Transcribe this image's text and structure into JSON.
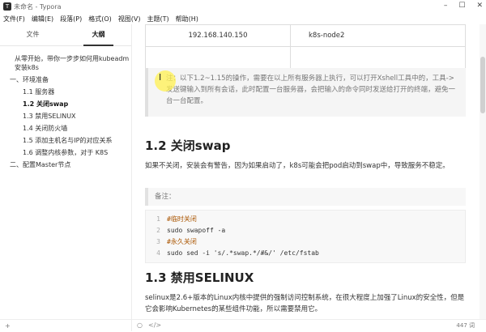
{
  "window": {
    "title": "未命名 - Typora",
    "app_icon": "T"
  },
  "menu": [
    "文件(F)",
    "编辑(E)",
    "段落(P)",
    "格式(O)",
    "视图(V)",
    "主题(T)",
    "帮助(H)"
  ],
  "sidebar": {
    "tabs": [
      "文件",
      "大纲"
    ],
    "active_tab": "大纲",
    "outline": [
      {
        "level": 1,
        "text": "从零开始，带你一步步如何用kubeadm安装k8s"
      },
      {
        "level": 2,
        "text": "一、环境准备"
      },
      {
        "level": 3,
        "text": "1.1 服务器"
      },
      {
        "level": 3,
        "text": "1.2 关闭swap",
        "active": true
      },
      {
        "level": 3,
        "text": "1.3 禁用SELINUX"
      },
      {
        "level": 3,
        "text": "1.4 关闭防火墙"
      },
      {
        "level": 3,
        "text": "1.5 添加主机名与IP的对应关系"
      },
      {
        "level": 3,
        "text": "1.6 调整内核参数，对于 K8S"
      },
      {
        "level": 2,
        "text": "二、配置Master节点"
      }
    ]
  },
  "table": {
    "rows": [
      {
        "ip": "192.168.140.150",
        "name": "k8s-node2"
      },
      {
        "ip": "",
        "name": ""
      }
    ]
  },
  "note": {
    "text": "注：以下1.2~1.15的操作，需要在以上所有服务器上执行，可以打开Xshell工具中的，工具->发送键输入到所有会话，此时配置一台服务器，会把输入的命令同时发送给打开的终端，避免一台一台配置。"
  },
  "sections": [
    {
      "heading": "1.2 关闭swap",
      "para": "如果不关闭，安装会有警告，因为如果启动了，k8s可能会把pod启动到swap中，导致服务不稳定。"
    },
    {
      "heading": "1.3 禁用SELINUX",
      "para": "selinux是2.6+版本的Linux内核中提供的强制访问控制系统，在很大程度上加强了Linux的安全性，但是它会影响Kubernetes的某些组件功能，所以需要禁用它。"
    }
  ],
  "memo": "备注：",
  "code": [
    {
      "n": "1",
      "t": "#临时关闭"
    },
    {
      "n": "2",
      "t": "sudo swapoff -a"
    },
    {
      "n": "3",
      "t": "#永久关闭"
    },
    {
      "n": "4",
      "t": "sudo sed -i 's/.*swap.*/#&/' /etc/fstab"
    }
  ],
  "status": {
    "word_count": "447 词"
  },
  "icons": {
    "add": "plus-icon",
    "sidebar_toggle": "circle-icon",
    "source_mode": "code-icon"
  }
}
